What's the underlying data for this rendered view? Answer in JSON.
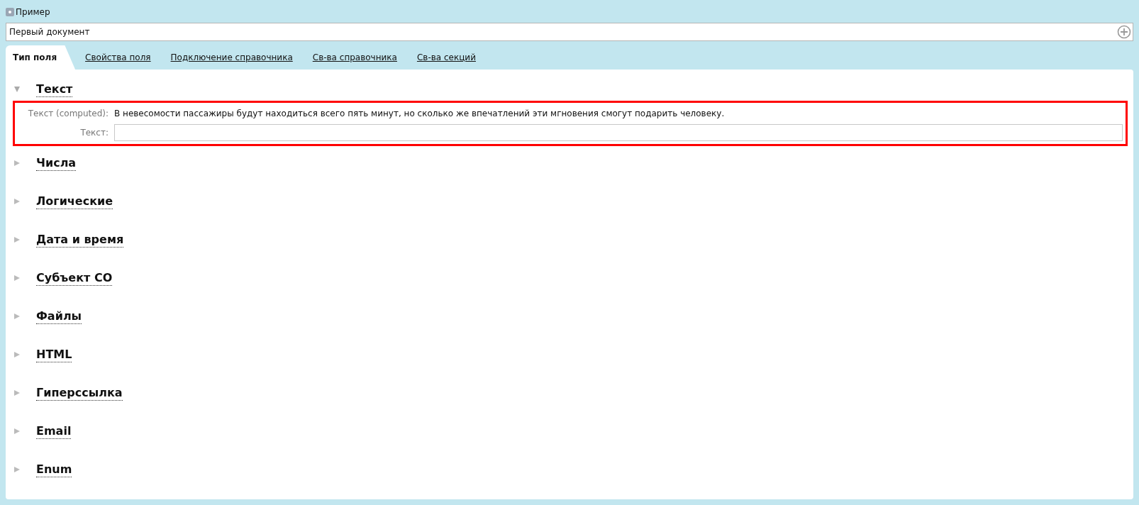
{
  "window": {
    "title": "Пример"
  },
  "document_field": {
    "value": "Первый документ"
  },
  "tabs": [
    {
      "label": "Тип поля",
      "selected": true
    },
    {
      "label": "Свойства поля",
      "selected": false
    },
    {
      "label": "Подключение справочника",
      "selected": false
    },
    {
      "label": "Св-ва справочника",
      "selected": false
    },
    {
      "label": "Св-ва секций",
      "selected": false
    }
  ],
  "sections": [
    {
      "title": "Текст",
      "expanded": true,
      "fields": [
        {
          "kind": "computed",
          "label": "Текст (computed):",
          "value": "В невесомости пассажиры будут находиться всего пять минут, но сколько же впечатлений эти мгновения смогут подарить человеку."
        },
        {
          "kind": "input",
          "label": "Текст:"
        }
      ]
    },
    {
      "title": "Числа",
      "expanded": false
    },
    {
      "title": "Логические",
      "expanded": false
    },
    {
      "title": "Дата и время",
      "expanded": false
    },
    {
      "title": "Субъект СО",
      "expanded": false
    },
    {
      "title": "Файлы",
      "expanded": false
    },
    {
      "title": "HTML",
      "expanded": false
    },
    {
      "title": "Гиперссылка",
      "expanded": false
    },
    {
      "title": "Email",
      "expanded": false
    },
    {
      "title": "Enum",
      "expanded": false
    }
  ]
}
